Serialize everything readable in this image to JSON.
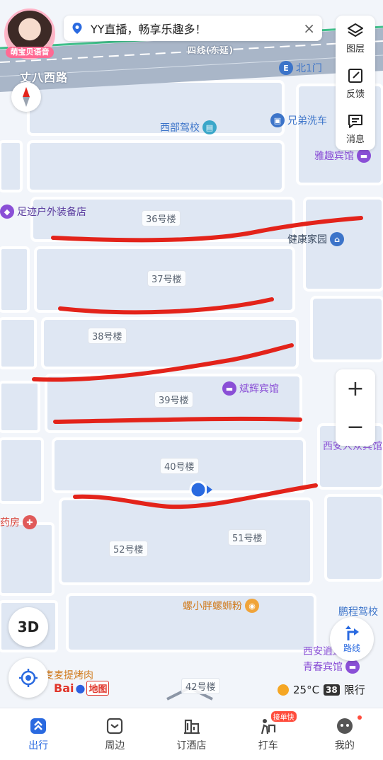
{
  "banner": {
    "text": "YY直播，畅享乐趣多！",
    "close": "×"
  },
  "avatar": {
    "tag": "萌宝贝语音"
  },
  "toolbar": {
    "layers": "图层",
    "feedback": "反馈",
    "messages": "消息"
  },
  "zoom": {
    "in": "+",
    "out": "−"
  },
  "map": {
    "roads": {
      "main": "丈八西路",
      "line": "四线(东延)"
    },
    "buildings": [
      "36号楼",
      "37号楼",
      "38号楼",
      "39号楼",
      "40号楼",
      "51号楼",
      "52号楼",
      "42号楼"
    ],
    "pois": {
      "north_gate": "北1门",
      "driving_school": "西部驾校",
      "car_wash": "兄弟洗车",
      "hotel_yaqu": "雅趣宾馆",
      "outdoor": "足迹户外装备店",
      "health": "健康家园",
      "hotel_binhui": "斌辉宾馆",
      "xian_hotel": "西安人众宾馆",
      "pharmacy": "药房",
      "luosifen": "螺小胖螺蛳粉",
      "pengcheng": "鹏程驾校",
      "xian_youth": "西安逍遥",
      "youth_hotel": "青春宾馆",
      "maimai": "麦麦提烤肉"
    }
  },
  "controls": {
    "btn_3d": "3D",
    "route": "路线"
  },
  "branding": {
    "baidu": "Bai",
    "map": "地图"
  },
  "weather": {
    "temp": "25°C",
    "limit_num": "38",
    "limit_label": "限行"
  },
  "nav": [
    {
      "label": "出行",
      "icon": "travel-icon",
      "active": true
    },
    {
      "label": "周边",
      "icon": "nearby-icon"
    },
    {
      "label": "订酒店",
      "icon": "hotel-icon"
    },
    {
      "label": "打车",
      "icon": "taxi-icon",
      "badge": "接单快"
    },
    {
      "label": "我的",
      "icon": "profile-icon"
    }
  ],
  "colors": {
    "accent": "#2a6ae0",
    "annotation": "#e3231a",
    "road": "#a9b6c8"
  }
}
